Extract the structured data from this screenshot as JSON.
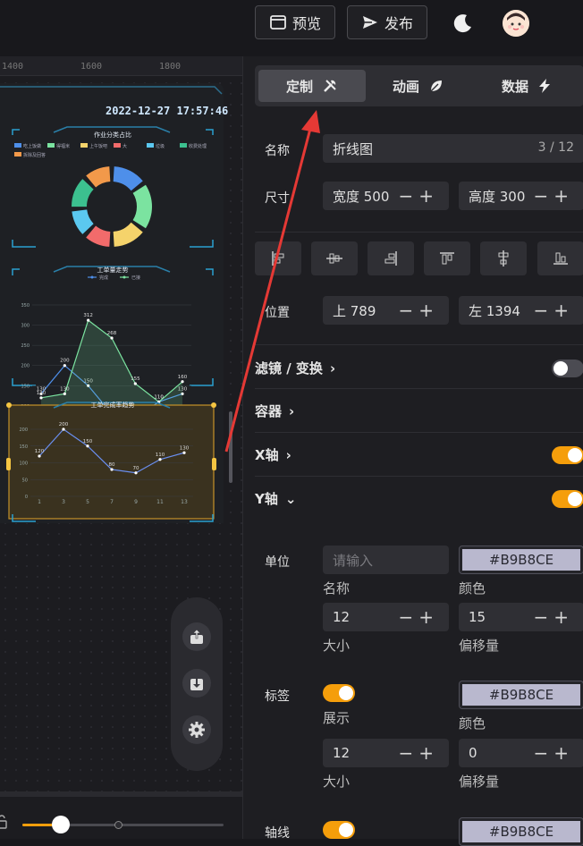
{
  "toolbar": {
    "preview_label": "预览",
    "publish_label": "发布"
  },
  "ruler": {
    "ticks": [
      "1400",
      "1600",
      "1800"
    ]
  },
  "canvas": {
    "datetime": "2022-12-27 17:57:46",
    "chart1": {
      "title": "作业分类占比",
      "legend": [
        "吃上饭做",
        "得福米",
        "上午饭吧",
        "大",
        "垃圾",
        "收费处理",
        "拆除及回答"
      ]
    },
    "chart2": {
      "title": "工单量走势",
      "legend": [
        "完成",
        "已接"
      ]
    },
    "chart3": {
      "title": "工单完成率趋势"
    }
  },
  "chart_data": [
    {
      "type": "pie",
      "title": "作业分类占比",
      "categories": [
        "吃上饭做",
        "得福米",
        "上午饭吧",
        "大",
        "垃圾",
        "收费处理",
        "拆除及回答"
      ],
      "values": [
        15,
        20,
        15,
        12,
        12,
        14,
        12
      ]
    },
    {
      "type": "line",
      "title": "工单量走势",
      "x": [
        1,
        3,
        5,
        7,
        9,
        11,
        13
      ],
      "ylim": [
        0,
        350
      ],
      "series": [
        {
          "name": "完成",
          "values": [
            130,
            200,
            150,
            80,
            70,
            110,
            130
          ]
        },
        {
          "name": "已接",
          "values": [
            120,
            130,
            312,
            268,
            155,
            110,
            160
          ]
        }
      ]
    },
    {
      "type": "line",
      "title": "工单完成率趋势",
      "x": [
        1,
        3,
        5,
        7,
        9,
        11,
        13
      ],
      "ylim": [
        0,
        200
      ],
      "series": [
        {
          "values": [
            120,
            200,
            150,
            80,
            70,
            110,
            130
          ]
        }
      ]
    }
  ],
  "panel": {
    "tabs": [
      {
        "label": "定制"
      },
      {
        "label": "动画"
      },
      {
        "label": "数据"
      }
    ],
    "name_label": "名称",
    "name_value": "折线图",
    "name_count": "3 / 12",
    "size_label": "尺寸",
    "width_value": "宽度 500",
    "height_value": "高度 300",
    "pos_label": "位置",
    "top_value": "上 789",
    "left_value": "左 1394",
    "sections": {
      "filter": "滤镜 / 变换",
      "container": "容器",
      "xaxis": "X轴",
      "yaxis": "Y轴"
    },
    "yaxis": {
      "unit_label": "单位",
      "unit_placeholder": "请输入",
      "unit_color": "#B9B8CE",
      "name_caption": "名称",
      "color_caption": "颜色",
      "font_size": "12",
      "offset": "15",
      "size_caption": "大小",
      "offset_caption": "偏移量",
      "tick_label": "标签",
      "tick_show_caption": "展示",
      "tick_color": "#B9B8CE",
      "tick_color_caption": "颜色",
      "tick_size": "12",
      "tick_offset": "0",
      "tick_size_caption": "大小",
      "tick_offset_caption": "偏移量",
      "axisline_label": "轴线",
      "axisline_color": "#B9B8CE"
    }
  }
}
